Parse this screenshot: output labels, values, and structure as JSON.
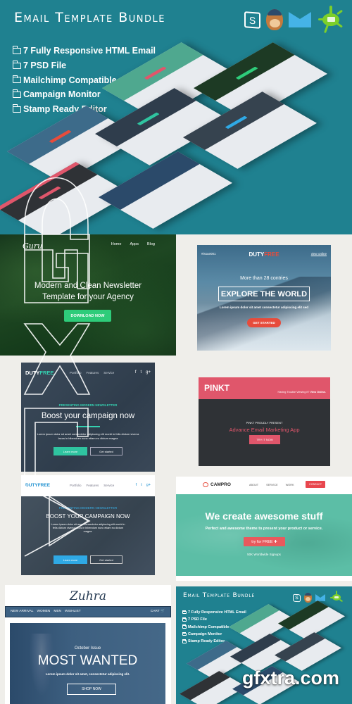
{
  "hero": {
    "title": "Email Template Bundle",
    "features": [
      "7 Fully Responsive HTML Email",
      "7 PSD File",
      "Mailchimp Compatible",
      "Campaign Monitor",
      "Stamp Ready Editor"
    ],
    "brand_icons": [
      "stampready-icon",
      "mailchimp-icon",
      "campaign-monitor-icon",
      "splat-email-icon"
    ],
    "stampready_letter": "S",
    "bg_color": "#1f8190"
  },
  "guru": {
    "logo": "Guru",
    "nav": [
      "Home",
      "Apps",
      "Blog"
    ],
    "headline_1": "Modern and Clean Newsletter",
    "headline_2": "Template for your Agency",
    "button": "DOWNLOAD NOW",
    "accent": "#2ecc7a"
  },
  "dutyfree_explore": {
    "issue": "#issue001",
    "logo_a": "DUTY",
    "logo_b": "FREE",
    "view_online": "view online",
    "subtitle": "More than 28 contries",
    "headline": "EXPLORE THE WORLD",
    "lorem": "Lorem ipsum dolor sit amet consectetur adipiscing elit sed",
    "button": "GET STARTED",
    "accent": "#e74c3c"
  },
  "dutyfree_boost": {
    "logo_a": "DUTY",
    "logo_b": "FREE",
    "nav": [
      "Portfolio",
      "Features",
      "Service"
    ],
    "social": [
      "f",
      "t",
      "g+"
    ],
    "pretitle": "PRESENTING MODERN NEWSLETTER",
    "headline": "Boost your campaign now",
    "lorem": "Lorem ipsum dolor sit amet consectetur adipiscing elit morbi in felis dictum viverra lacus in bibendum nunc etiam eu dictum magna",
    "primary_button": "Learn more",
    "secondary_button": "Get started",
    "accent": "#2fc4a0"
  },
  "pinkt": {
    "logo": "PINKT",
    "trouble_text": "Having Trouble Viewing it?",
    "view_online": "View Online.",
    "presents": "PINKT PROUDLY PRESENT",
    "headline": "Advance Email Marketing App",
    "button": "TRY IT NOW",
    "accent": "#e0566b"
  },
  "dutyfree_blue": {
    "logo": "DUTYFREE",
    "nav": [
      "Portfolio",
      "Features",
      "Service"
    ],
    "social": [
      "f",
      "t",
      "g+"
    ],
    "pretitle": "PRESENTING MODERN NEWSLETTER",
    "headline": "BOOST YOUR CAMPAIGN NOW",
    "lorem": "Lorem ipsum dolor sit amet consectetur adipiscing elit morbi in felis dictum viverra lacus in bibendum nunc etiam eu dictum magna.",
    "primary_button": "Learn more",
    "secondary_button": "Get started",
    "accent": "#2fa9e5"
  },
  "campro": {
    "logo": "CAMPRO",
    "nav": [
      "ABOUT",
      "SERVICE",
      "WORK"
    ],
    "contact": "CONTACT",
    "headline": "We create awesome stuff",
    "subtitle": "Perfect and awesome theme to present your product or service.",
    "button": "try for FREE ✚",
    "signups": "50K Worldwide Signups",
    "accent": "#5cbea6"
  },
  "zuhra": {
    "logo": "Zuhra",
    "nav": [
      "NEW ARRIVAL",
      "WOMEN",
      "MEN",
      "WISHLIST"
    ],
    "cart": "CART 🛒",
    "issue": "October Issue",
    "headline": "MOST WANTED",
    "lorem": "Lorem ipsum dolor sit amet, consectetur adipiscing elit.",
    "button": "SHOP NOW"
  },
  "mini_preview": {
    "title": "Email Template Bundle",
    "features": [
      "7 Fully Responsive HTML Email",
      "7 PSD File",
      "Mailchimp Compatible",
      "Campaign Monitor",
      "Stamp Ready Editor"
    ]
  },
  "watermark": "gfxtra.com"
}
